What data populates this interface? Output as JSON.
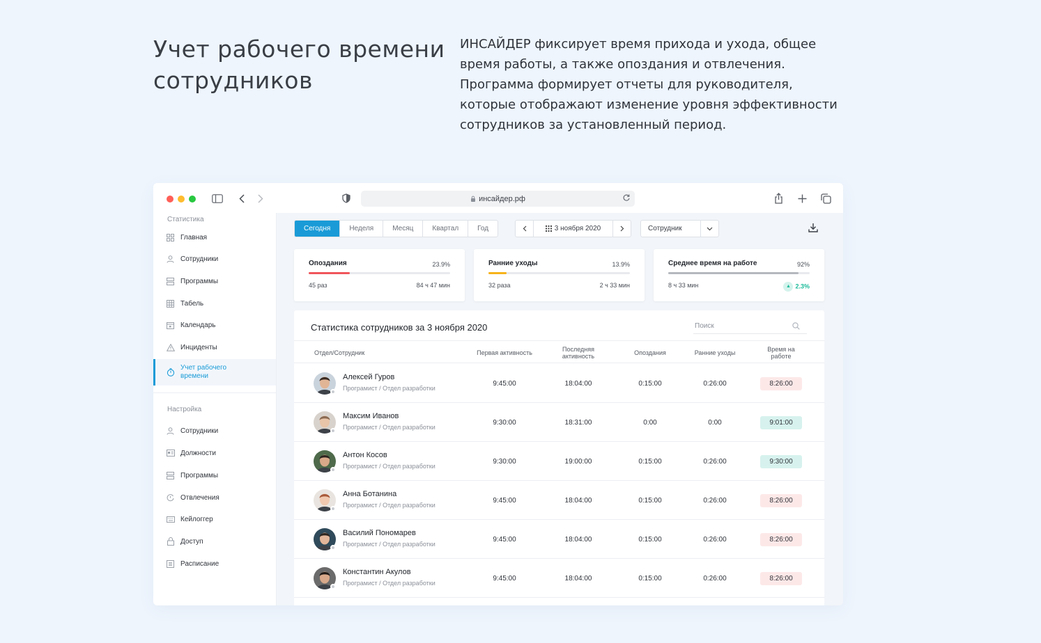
{
  "hero": {
    "title": "Учет рабочего времени сотрудников",
    "text": "ИНСАЙДЕР фиксирует время прихода и ухода, общее время работы, а также опоздания и отвлечения. Программа формирует отчеты для руководителя, которые отображают изменение уровня эффективности сотрудников за установленный период."
  },
  "browser": {
    "url": "инсайдер.рф"
  },
  "sidebar": {
    "stats_section": "Статистика",
    "stats_items": [
      {
        "label": "Главная",
        "icon": "dashboard-icon"
      },
      {
        "label": "Сотрудники",
        "icon": "user-icon"
      },
      {
        "label": "Программы",
        "icon": "programs-icon"
      },
      {
        "label": "Табель",
        "icon": "table-icon"
      },
      {
        "label": "Календарь",
        "icon": "calendar-icon"
      },
      {
        "label": "Инциденты",
        "icon": "warning-icon"
      },
      {
        "label": "Учет рабочего времени",
        "icon": "timer-icon",
        "active": true
      }
    ],
    "settings_section": "Настройка",
    "settings_items": [
      {
        "label": "Сотрудники",
        "icon": "user-icon"
      },
      {
        "label": "Должности",
        "icon": "id-card-icon"
      },
      {
        "label": "Программы",
        "icon": "programs-icon"
      },
      {
        "label": "Отвлечения",
        "icon": "distraction-icon"
      },
      {
        "label": "Кейлоггер",
        "icon": "keyboard-icon"
      },
      {
        "label": "Доступ",
        "icon": "lock-icon"
      },
      {
        "label": "Расписание",
        "icon": "schedule-icon"
      }
    ]
  },
  "toolbar": {
    "periods": [
      "Сегодня",
      "Неделя",
      "Месяц",
      "Квартал",
      "Год"
    ],
    "active_period": "Сегодня",
    "date": "3 ноября 2020",
    "employee_select": "Сотрудник"
  },
  "cards": [
    {
      "title": "Опоздания",
      "percent": "23.9%",
      "progress": 0.29,
      "color": "#f0565b",
      "left": "45 раз",
      "right": "84 ч 47 мин",
      "up": false
    },
    {
      "title": "Ранние уходы",
      "percent": "13.9%",
      "progress": 0.13,
      "color": "#f7b21a",
      "left": "32 раза",
      "right": "2 ч 33 мин",
      "up": false
    },
    {
      "title": "Среднее время на работе",
      "percent": "92%",
      "progress": 0.92,
      "color": "#b5b8be",
      "left": "8 ч 33 мин",
      "right": "2.3%",
      "up": true
    }
  ],
  "table": {
    "title": "Статистика сотрудников за 3 ноября 2020",
    "search_placeholder": "Поиск",
    "headers": [
      "Отдел/Сотрудник",
      "Первая активность",
      "Последняя активность",
      "Опоздания",
      "Ранние уходы",
      "Время на работе"
    ],
    "rows": [
      {
        "name": "Алексей Гуров",
        "dept": "Програмист / Отдел разработки",
        "first": "9:45:00",
        "last": "18:04:00",
        "late": "0:15:00",
        "early": "0:26:00",
        "total": "8:26:00",
        "status": "red",
        "skin": "#e0b596",
        "hair": "#3a2a22",
        "bg": "#c9d3dc"
      },
      {
        "name": "Максим Иванов",
        "dept": "Програмист / Отдел разработки",
        "first": "9:30:00",
        "last": "18:31:00",
        "late": "0:00",
        "early": "0:00",
        "total": "9:01:00",
        "status": "green",
        "skin": "#e8c4a8",
        "hair": "#8a6a52",
        "bg": "#d8d2cc"
      },
      {
        "name": "Антон Косов",
        "dept": "Програмист / Отдел разработки",
        "first": "9:30:00",
        "last": "19:00:00",
        "late": "0:15:00",
        "early": "0:26:00",
        "total": "9:30:00",
        "status": "green",
        "skin": "#d9a98a",
        "hair": "#2c2420",
        "bg": "#4e6a4a"
      },
      {
        "name": "Анна Ботанина",
        "dept": "Програмист / Отдел разработки",
        "first": "9:45:00",
        "last": "18:04:00",
        "late": "0:15:00",
        "early": "0:26:00",
        "total": "8:26:00",
        "status": "red",
        "skin": "#f0c9b0",
        "hair": "#a85a3a",
        "bg": "#e9e4df"
      },
      {
        "name": "Василий Пономарев",
        "dept": "Програмист / Отдел разработки",
        "first": "9:45:00",
        "last": "18:04:00",
        "late": "0:15:00",
        "early": "0:26:00",
        "total": "8:26:00",
        "status": "red",
        "skin": "#e2b69a",
        "hair": "#2e2620",
        "bg": "#2f4a5a"
      },
      {
        "name": "Константин Акулов",
        "dept": "Програмист / Отдел разработки",
        "first": "9:45:00",
        "last": "18:04:00",
        "late": "0:15:00",
        "early": "0:26:00",
        "total": "8:26:00",
        "status": "red",
        "skin": "#d7a88a",
        "hair": "#1f1a18",
        "bg": "#6b6b6b"
      }
    ]
  }
}
